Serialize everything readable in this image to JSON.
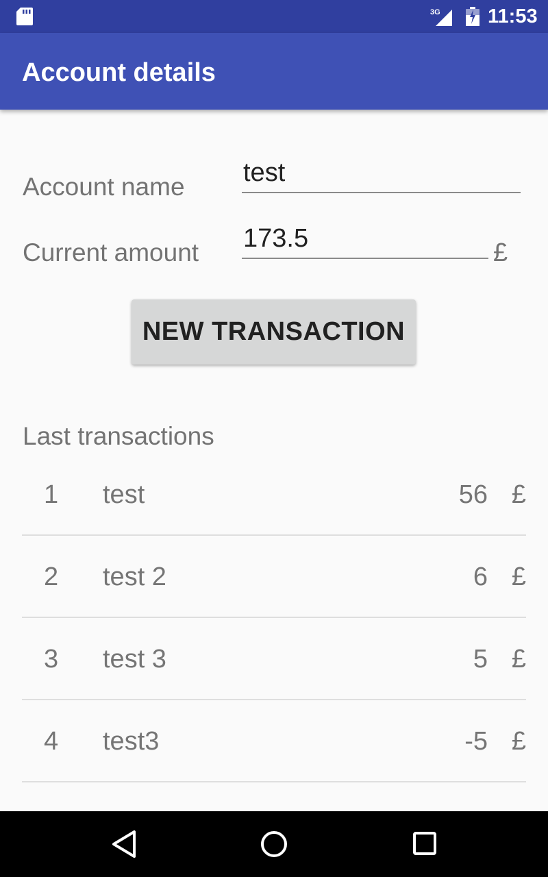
{
  "status_bar": {
    "network": "3G",
    "time": "11:53",
    "icons": [
      "sd-card-icon",
      "signal-icon",
      "battery-icon"
    ]
  },
  "app_bar": {
    "title": "Account details"
  },
  "form": {
    "account_name_label": "Account name",
    "account_name_value": "test",
    "current_amount_label": "Current amount",
    "current_amount_value": "173.5",
    "currency": "£"
  },
  "new_transaction_button": "NEW TRANSACTION",
  "transactions": {
    "title": "Last transactions",
    "rows": [
      {
        "number": "1",
        "name": "test",
        "amount": "56",
        "currency": "£"
      },
      {
        "number": "2",
        "name": "test 2",
        "amount": "6",
        "currency": "£"
      },
      {
        "number": "3",
        "name": "test 3",
        "amount": "5",
        "currency": "£"
      },
      {
        "number": "4",
        "name": "test3",
        "amount": "-5",
        "currency": "£"
      }
    ]
  },
  "nav_bar": {
    "icons": [
      "back-icon",
      "home-icon",
      "recent-apps-icon"
    ]
  },
  "colors": {
    "status_bar": "#303f9f",
    "app_bar": "#3f51b5",
    "background": "#fafafa",
    "button": "#d6d7d7"
  }
}
